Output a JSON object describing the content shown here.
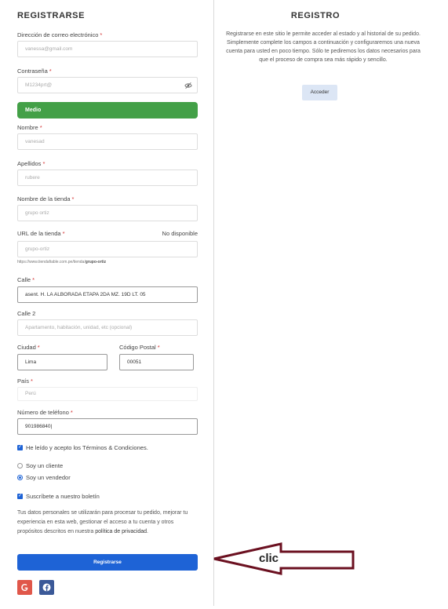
{
  "register": {
    "title": "REGISTRARSE",
    "email": {
      "label": "Dirección de correo electrónico",
      "value": "vanessa@gmail.com"
    },
    "password": {
      "label": "Contraseña",
      "value": "M1234prt@"
    },
    "strength": "Medio",
    "first_name": {
      "label": "Nombre",
      "value": "vanesad"
    },
    "last_name": {
      "label": "Apellidos",
      "value": "rubere"
    },
    "store_name": {
      "label": "Nombre de la tienda",
      "value": "grupo ortiz"
    },
    "store_url": {
      "label": "URL de la tienda",
      "status": "No disponible",
      "value": "grupo-ortiz",
      "hint_prefix": "https://www.tiendafiable.com.pe/tienda/",
      "hint_slug": "grupo-ortiz"
    },
    "street": {
      "label": "Calle",
      "value": "asent. H. LA ALBORADA ETAPA 2DA MZ. 19D LT. 05"
    },
    "street2": {
      "label": "Calle 2",
      "placeholder": "Apartamento, habitación, unidad, etc (opcional)"
    },
    "city": {
      "label": "Ciudad",
      "value": "Lima"
    },
    "postal": {
      "label": "Código Postal",
      "value": "00051"
    },
    "country": {
      "label": "País",
      "value": "Perú"
    },
    "phone": {
      "label": "Número de teléfono",
      "value": "901986840"
    },
    "terms": "He leído y acepto los Términos & Condiciones.",
    "role_client": "Soy un cliente",
    "role_vendor": "Soy un vendedor",
    "newsletter": "Suscríbete a nuestro boletín",
    "privacy_text": "Tus datos personales se utilizarán para procesar tu pedido, mejorar tu experiencia en esta web, gestionar el acceso a tu cuenta y otros propósitos descritos en nuestra",
    "privacy_link": "política de privacidad",
    "submit": "Registrarse",
    "required_mark": "*"
  },
  "login": {
    "title": "REGISTRO",
    "description": "Registrarse en este sitio le permite acceder al estado y al historial de su pedido. Simplemente complete los campos a continuación y configuraremos una nueva cuenta para usted en poco tiempo. Sólo te pediremos los datos necesarios para que el proceso de compra sea más rápido y sencillo.",
    "button": "Acceder"
  },
  "annotation": {
    "text": "clic",
    "color": "#6b1020"
  },
  "colors": {
    "primary": "#1e63d6",
    "strength": "#43a047",
    "google": "#e0574a",
    "facebook": "#3b5998",
    "required": "#d32f2f"
  },
  "icons": [
    "eye-slash-icon",
    "google-icon",
    "facebook-icon",
    "checkbox-checked-icon",
    "annotation-arrow-icon"
  ]
}
